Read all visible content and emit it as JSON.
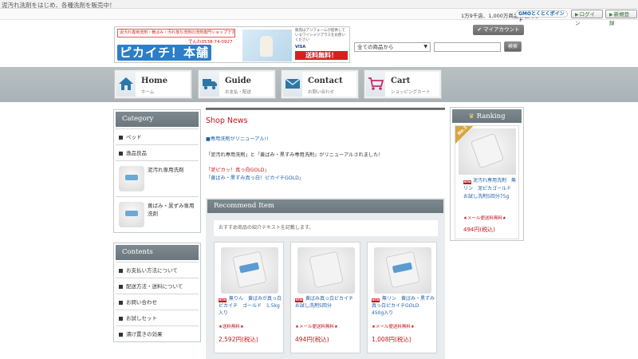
{
  "topbar": {
    "tagline": "泥汚れ洗剤をはじめ、各種洗剤を販売中！"
  },
  "subbar": {
    "count_text": "1万9千店、1,000万商品で使える",
    "gmo_logo_text": "GMOとくとくポイント",
    "login_label": "ログイン",
    "register_label": "新規登録"
  },
  "banner": {
    "note": "泥汚れ専用洗剤・黄ばみ・汚れ落ち洗剤の洗剤専門ショップです！",
    "tel": "でんわ0538-74-0927",
    "logo": "ピカイチ！本舗",
    "side_text": "販売はアリフォームが提供しているワイシャツプラスをお使いください",
    "cards": "VISA",
    "free_shipping": "送料無料！"
  },
  "header": {
    "mypage_label": "マイアカウント",
    "search_select": "全ての商品から",
    "search_button": "検索"
  },
  "nav": [
    {
      "label": "Home",
      "sub": "ホーム",
      "icon": "home-icon"
    },
    {
      "label": "Guide",
      "sub": "お支払・配送",
      "icon": "truck-icon"
    },
    {
      "label": "Contact",
      "sub": "お問い合わせ",
      "icon": "mail-icon"
    },
    {
      "label": "Cart",
      "sub": "ショッピングカート",
      "icon": "cart-icon"
    }
  ],
  "colors": {
    "accent_red": "#c4161c",
    "link_blue": "#2260a8",
    "panel_head": "#6b777d",
    "nav_band": "#adb6ba"
  },
  "category": {
    "title": "Category",
    "items": [
      {
        "label": "ペッド",
        "type": "text"
      },
      {
        "label": "逸品良品",
        "type": "text"
      },
      {
        "label": "泥汚れ専用洗剤",
        "type": "image"
      },
      {
        "label": "黄ばみ・黒ずみ専用洗剤",
        "type": "image"
      }
    ]
  },
  "contents": {
    "title": "Contents",
    "items": [
      "お支払い方法について",
      "配送方法・送料について",
      "お問い合わせ",
      "お試しセット",
      "漬け置きの効果"
    ]
  },
  "news": {
    "title": "Shop News",
    "headline": "■専用洗剤がリニューアル!!",
    "body": "「泥汚れ専用洗剤」と「黄ばみ・黒ずみ専用洗剤」がリニューアルされました！",
    "line_red": "「泥ピカッ！真っ白GOLD」",
    "line_blue": "「黄ばみ・黒ずみ真っ白！ピカイチGOLD」"
  },
  "recommend": {
    "title": "Recommend Item",
    "intro": "おすすめ商品の紹介テキストを記載します。",
    "items": [
      {
        "name": "無りん　黄ばみが真っ白ピカイチ　ゴールド　1.5kg入り",
        "ship": "★送料無料★",
        "price": "2,592円(税込)"
      },
      {
        "name": "黄ばみ真っ白ピカイチ　お試し洗剤5回分",
        "ship": "★メール便送料無料★",
        "price": "494円(税込)"
      },
      {
        "name": "無リン　黄ばみ・黒ずみ真っ白ピカイチGOLD　450g入り",
        "ship": "★メール便送料無料★",
        "price": "1,008円(税込)"
      }
    ]
  },
  "ranking": {
    "title": "Ranking",
    "badge": "No.1",
    "item": {
      "name": "泥汚れ専用洗剤　無リン　泥ピカゴールド　お試し洗剤5回分75g",
      "ship": "★メール便送料無料★",
      "price": "494円(税込)"
    }
  },
  "new_badge": "NEW"
}
